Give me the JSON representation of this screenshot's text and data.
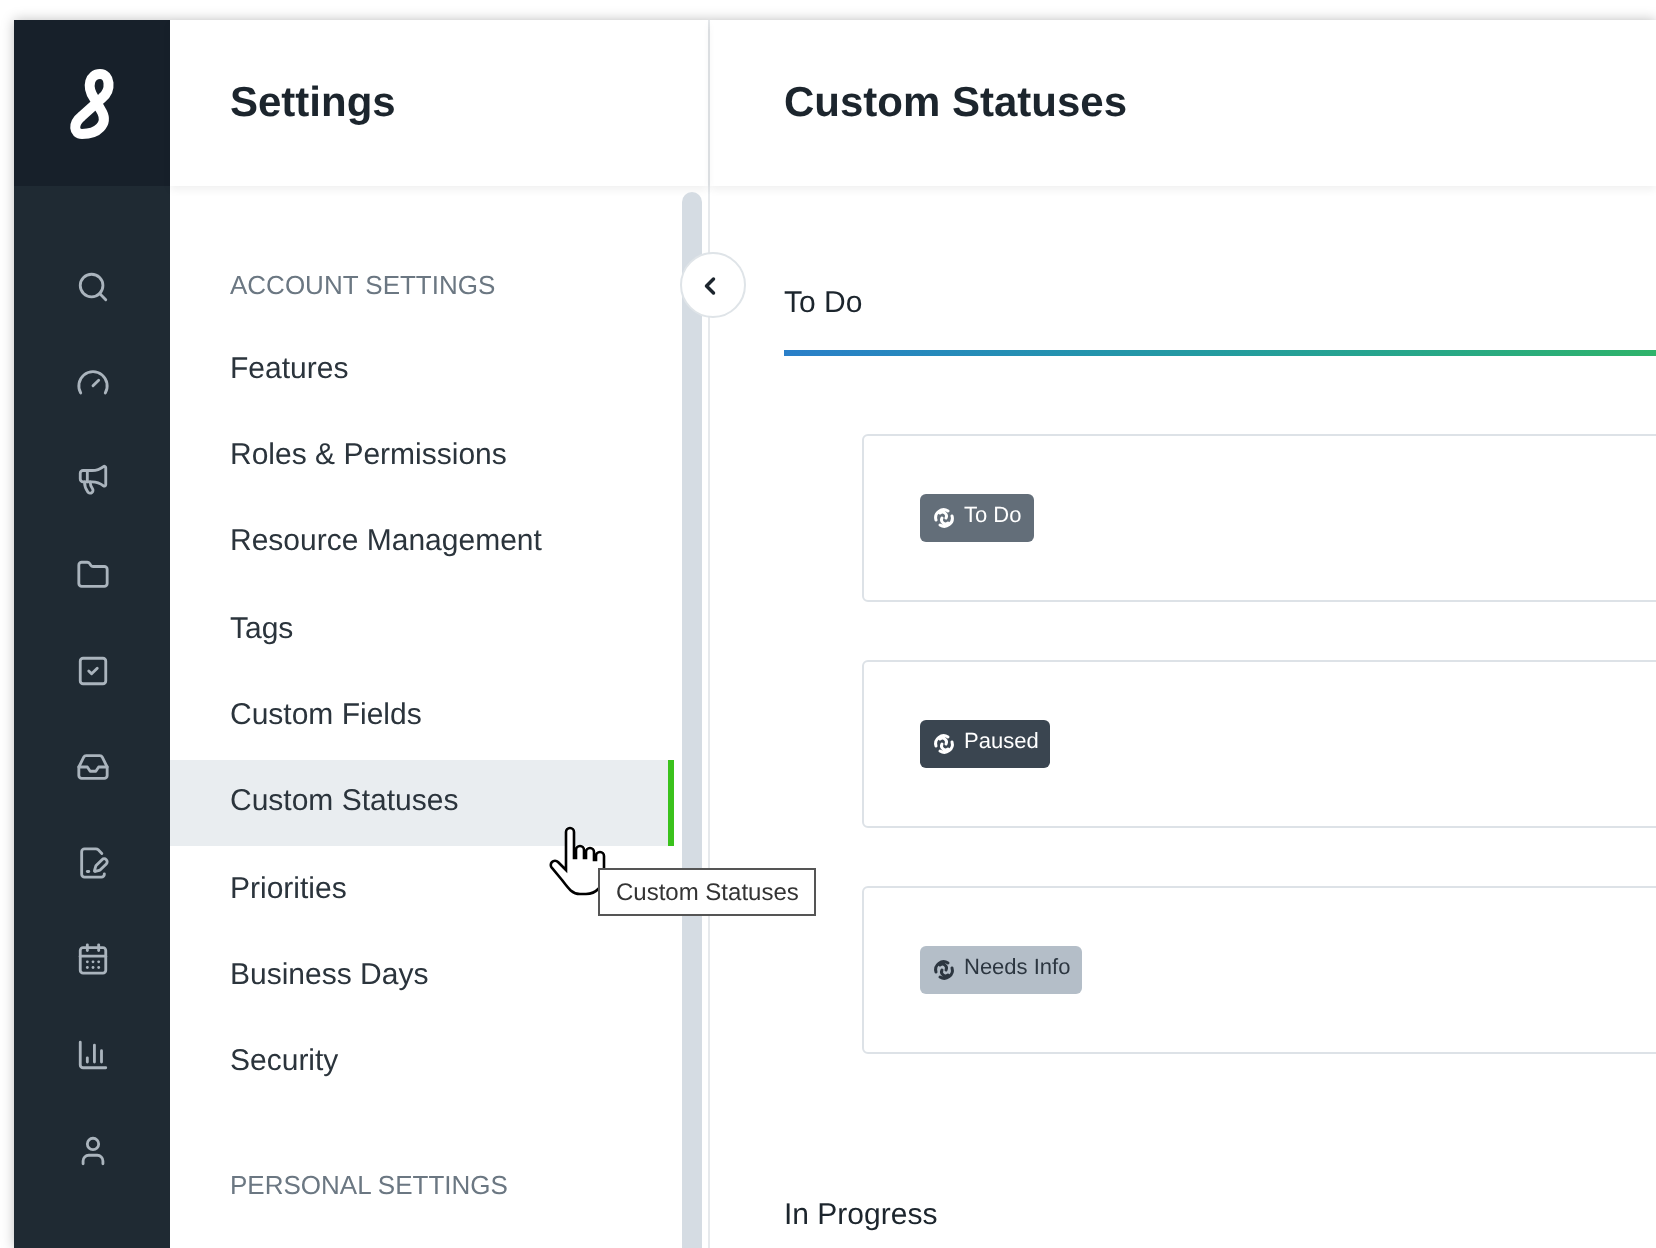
{
  "sidebar": {
    "title": "Settings",
    "sections": [
      {
        "heading": "ACCOUNT SETTINGS",
        "items": [
          {
            "label": "Features",
            "selected": false
          },
          {
            "label": "Roles & Permissions",
            "selected": false
          },
          {
            "label": "Resource Management",
            "selected": false
          },
          {
            "label": "Tags",
            "selected": false
          },
          {
            "label": "Custom Fields",
            "selected": false
          },
          {
            "label": "Custom Statuses",
            "selected": true
          },
          {
            "label": "Priorities",
            "selected": false
          },
          {
            "label": "Business Days",
            "selected": false
          },
          {
            "label": "Security",
            "selected": false
          }
        ]
      },
      {
        "heading": "PERSONAL SETTINGS"
      }
    ]
  },
  "tooltip": "Custom Statuses",
  "main": {
    "title": "Custom Statuses",
    "groups": [
      {
        "title": "To Do",
        "underline": true,
        "statuses": [
          {
            "label": "To Do",
            "color": "#636e79"
          },
          {
            "label": "Paused",
            "color": "#3a4550"
          },
          {
            "label": "Needs Info",
            "color": "#b4bec8"
          }
        ]
      },
      {
        "title": "In Progress",
        "underline": false
      }
    ]
  }
}
